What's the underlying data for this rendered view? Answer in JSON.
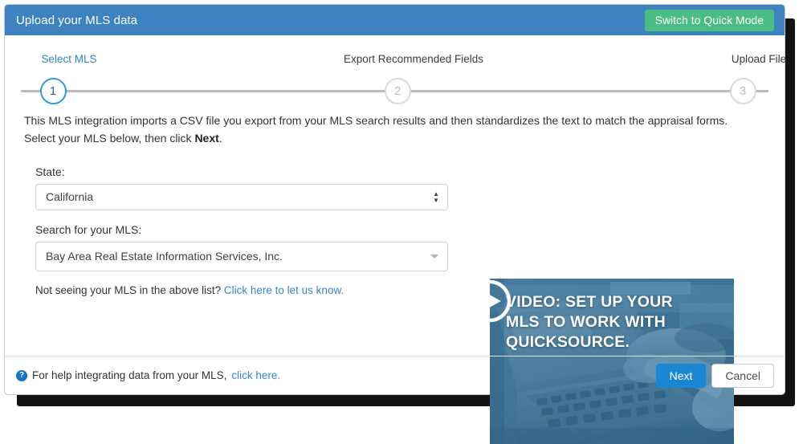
{
  "header": {
    "title": "Upload your MLS data",
    "quick_mode_label": "Switch to Quick Mode",
    "bar_color": "#3c83c0",
    "quick_mode_color": "#4bbd84"
  },
  "stepper": {
    "steps": [
      {
        "number": "1",
        "label": "Select MLS",
        "state": "active"
      },
      {
        "number": "2",
        "label": "Export Recommended Fields",
        "state": "inactive"
      },
      {
        "number": "3",
        "label": "Upload File",
        "state": "inactive"
      }
    ],
    "active_color": "#2e9bd6",
    "inactive_color": "#dadada"
  },
  "body": {
    "intro_line1": "This MLS integration imports a CSV file you export from your MLS search results and then standardizes the text to match the appraisal forms.",
    "intro_line2_before": "Select your MLS below, then click ",
    "intro_line2_bold": "Next",
    "intro_line2_after": ".",
    "state_label": "State:",
    "state_value": "California",
    "mls_label": "Search for your MLS:",
    "mls_value": "Bay Area Real Estate Information Services, Inc.",
    "not_seeing_text": "Not seeing your MLS in the above list? ",
    "not_seeing_link": "Click here to let us know.",
    "link_color": "#3a86c8"
  },
  "video": {
    "caption": "VIDEO: SET UP YOUR MLS TO WORK WITH QUICKSOURCE.",
    "play_icon": "play-icon",
    "tint_color": "#3f7396"
  },
  "footer": {
    "help_icon": "question-circle-icon",
    "help_text": "For help integrating data from your MLS, ",
    "help_link": "click here.",
    "next_label": "Next",
    "cancel_label": "Cancel",
    "next_color": "#1b87d2"
  }
}
